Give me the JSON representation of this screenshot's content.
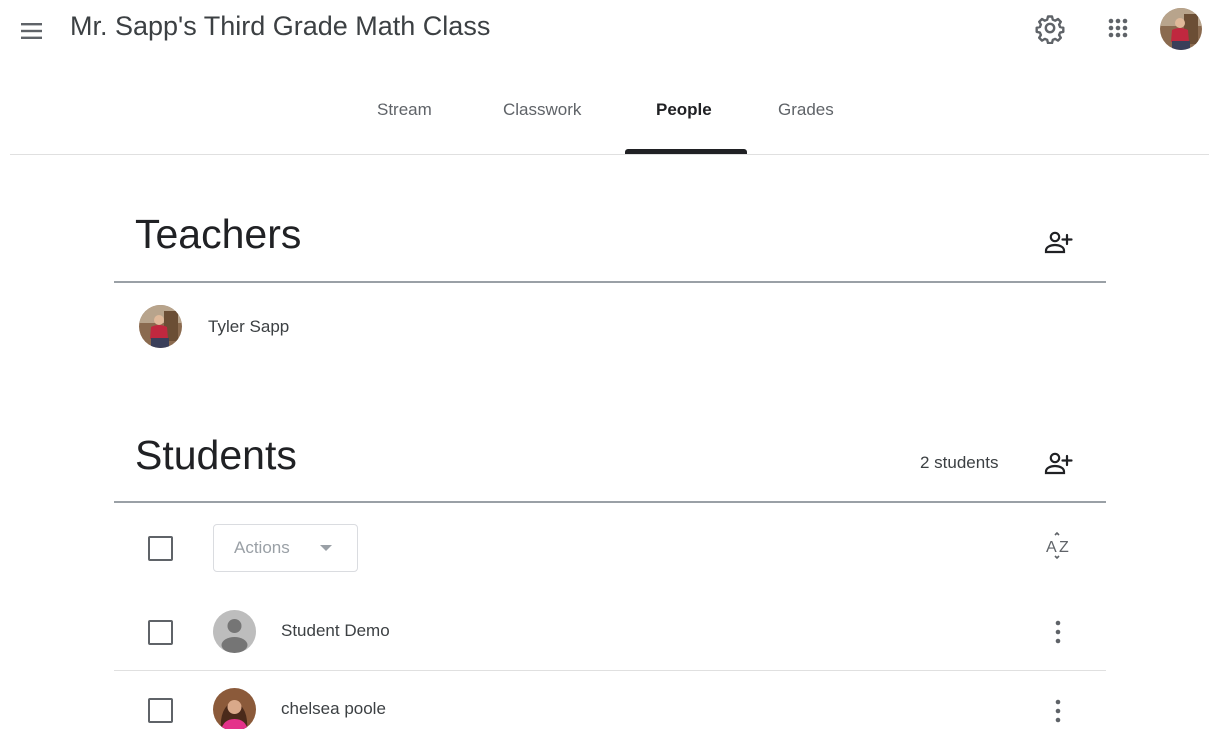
{
  "header": {
    "menu_icon": "hamburger-menu-icon",
    "class_title": "Mr. Sapp's Third Grade Math Class",
    "settings_icon": "gear-icon",
    "apps_icon": "apps-grid-icon",
    "account_avatar": "account-avatar-photo"
  },
  "tabs": [
    {
      "label": "Stream",
      "active": false
    },
    {
      "label": "Classwork",
      "active": false
    },
    {
      "label": "People",
      "active": true
    },
    {
      "label": "Grades",
      "active": false
    }
  ],
  "teachers": {
    "title": "Teachers",
    "invite_icon": "person-add-icon",
    "list": [
      {
        "name": "Tyler Sapp",
        "avatar": "photo"
      }
    ]
  },
  "students": {
    "title": "Students",
    "count_label": "2 students",
    "invite_icon": "person-add-icon",
    "actions_label": "Actions",
    "sort_icon": "sort-az-icon",
    "list": [
      {
        "name": "Student Demo",
        "avatar": "default-person",
        "more_icon": "more-vert-icon"
      },
      {
        "name": "chelsea poole",
        "avatar": "photo",
        "more_icon": "more-vert-icon"
      }
    ]
  },
  "colors": {
    "text_primary": "#202124",
    "text_secondary": "#3c4043",
    "text_muted": "#5f6368",
    "divider": "#e0e0e0",
    "section_rule": "#9aa0a6",
    "avatar_default_bg": "#bdbdbd",
    "avatar_default_fg": "#757575"
  }
}
